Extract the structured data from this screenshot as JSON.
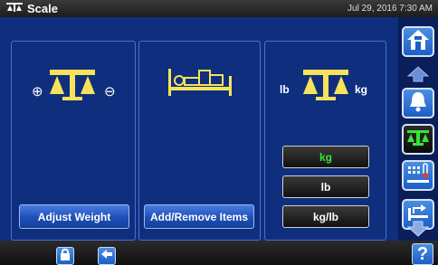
{
  "header": {
    "title": "Scale",
    "datetime": "Jul 29, 2016 7:30 AM",
    "icon": "scale-icon"
  },
  "panels": {
    "weight": {
      "plus_symbol": "⊕",
      "minus_symbol": "⊖",
      "icon": "scale-icon",
      "button_label": "Adjust Weight"
    },
    "items": {
      "icon": "bed-items-icon",
      "button_label": "Add/Remove Items"
    },
    "units": {
      "icon": "scale-icon",
      "left_unit": "lb",
      "right_unit": "kg",
      "options": [
        {
          "label": "kg",
          "selected": true
        },
        {
          "label": "lb",
          "selected": false
        },
        {
          "label": "kg/lb",
          "selected": false
        }
      ]
    }
  },
  "sidebar": {
    "items": [
      {
        "name": "home",
        "icon": "home-icon"
      },
      {
        "name": "up",
        "icon": "up-arrow-icon"
      },
      {
        "name": "alarm",
        "icon": "bell-icon"
      },
      {
        "name": "scale",
        "icon": "scale-icon"
      },
      {
        "name": "bed-mode",
        "icon": "bed-temperature-icon"
      },
      {
        "name": "down",
        "icon": "down-arrow-icon"
      },
      {
        "name": "bed-exit",
        "icon": "bed-exit-icon"
      }
    ]
  },
  "footer": {
    "lock_icon": "lock-icon",
    "back_icon": "back-arrow-icon",
    "help_label": "?"
  },
  "colors": {
    "panel_bg": "#0f2f7e",
    "panel_border": "#4a6fcf",
    "icon_yellow": "#f7e25a",
    "selected_text": "#35e635"
  }
}
